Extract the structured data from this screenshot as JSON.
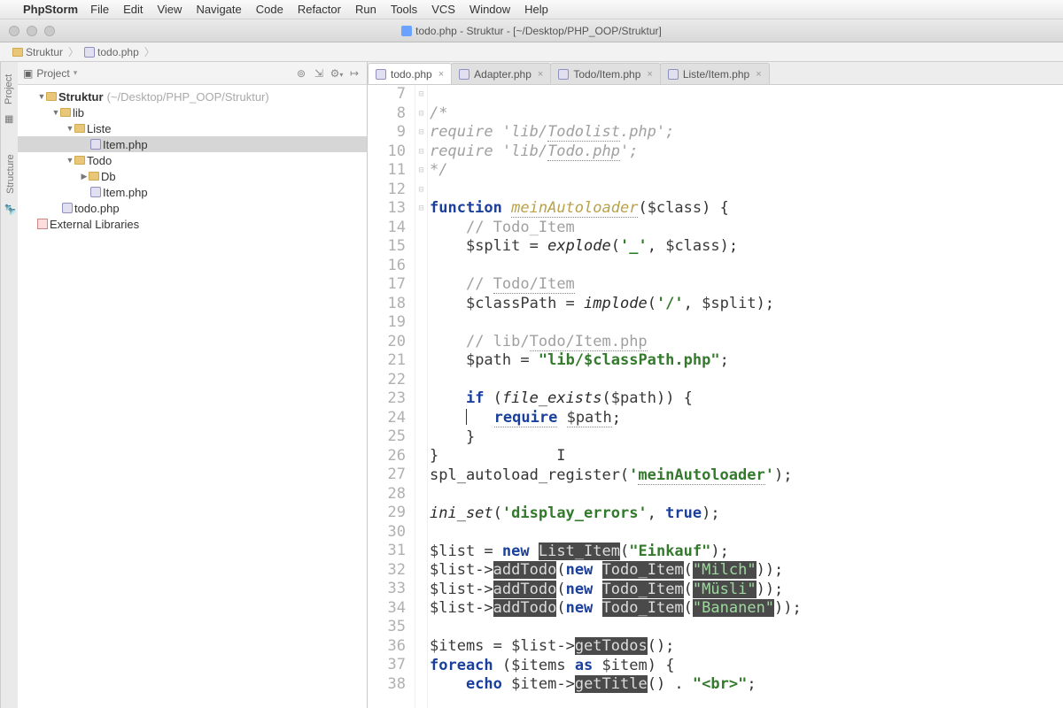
{
  "menubar": {
    "apple": "",
    "appname": "PhpStorm",
    "items": [
      "File",
      "Edit",
      "View",
      "Navigate",
      "Code",
      "Refactor",
      "Run",
      "Tools",
      "VCS",
      "Window",
      "Help"
    ]
  },
  "titlebar": {
    "title": "todo.php - Struktur - [~/Desktop/PHP_OOP/Struktur]"
  },
  "breadcrumb": {
    "items": [
      "Struktur",
      "todo.php"
    ]
  },
  "left_gutter": {
    "project": "Project",
    "structure": "Structure"
  },
  "sidebar": {
    "header": {
      "label": "Project"
    },
    "tree": {
      "root": {
        "label": "Struktur",
        "hint": "(~/Desktop/PHP_OOP/Struktur)"
      },
      "lib": "lib",
      "liste": "Liste",
      "liste_item": "Item.php",
      "todo": "Todo",
      "db": "Db",
      "todo_item": "Item.php",
      "todophp": "todo.php",
      "ext": "External Libraries"
    }
  },
  "tabs": [
    {
      "label": "todo.php",
      "active": true
    },
    {
      "label": "Adapter.php",
      "active": false
    },
    {
      "label": "Todo/Item.php",
      "active": false
    },
    {
      "label": "Liste/Item.php",
      "active": false
    }
  ],
  "code": {
    "first_line": 7,
    "lines": [
      {
        "n": 7,
        "html": ""
      },
      {
        "n": 8,
        "html": "<span class='c-cm'>/*</span>"
      },
      {
        "n": 9,
        "html": "<span class='c-cm'>require 'lib/</span><span class='c-cm c-ul'>Todolist</span><span class='c-cm'>.php';</span>"
      },
      {
        "n": 10,
        "html": "<span class='c-cm'>require 'lib/</span><span class='c-cm c-ul'>Todo.php</span><span class='c-cm'>';</span>"
      },
      {
        "n": 11,
        "html": "<span class='c-cm'>*/</span>"
      },
      {
        "n": 12,
        "html": ""
      },
      {
        "n": 13,
        "html": "<span class='c-kw'>function</span> <span class='c-def c-ul'>meinAutoloader</span>(<span class='c-var'>$class</span>) {"
      },
      {
        "n": 14,
        "html": "    <span class='c-cm2'>// Todo_Item</span>"
      },
      {
        "n": 15,
        "html": "    <span class='c-var'>$split</span> = <span class='c-fn'>explode</span>(<span class='c-str'>'_'</span>, <span class='c-var'>$class</span>);"
      },
      {
        "n": 16,
        "html": ""
      },
      {
        "n": 17,
        "html": "    <span class='c-cm2'>// </span><span class='c-cm2 c-ul'>Todo/Item</span>"
      },
      {
        "n": 18,
        "html": "    <span class='c-var'>$classPath</span> = <span class='c-fn'>implode</span>(<span class='c-str'>'/'</span>, <span class='c-var'>$split</span>);"
      },
      {
        "n": 19,
        "html": ""
      },
      {
        "n": 20,
        "html": "    <span class='c-cm2'>// lib/</span><span class='c-cm2 c-ul'>Todo/Item.php</span>"
      },
      {
        "n": 21,
        "html": "    <span class='c-var'>$path</span> = <span class='c-str'>\"lib/$classPath.php\"</span>;"
      },
      {
        "n": 22,
        "html": ""
      },
      {
        "n": 23,
        "html": "    <span class='c-kw'>if</span> (<span class='c-fn'>file_exists</span>(<span class='c-var'>$path</span>)) {"
      },
      {
        "n": 24,
        "html": "    <span class='caret'></span>   <span class='c-kw c-ul'>require</span> <span class='c-var c-ul'>$path</span>;"
      },
      {
        "n": 25,
        "html": "    }"
      },
      {
        "n": 26,
        "html": "}             I"
      },
      {
        "n": 27,
        "html": "spl_autoload_register(<span class='c-str'>'</span><span class='c-str c-ul'>meinAutoloader</span><span class='c-str'>'</span>);"
      },
      {
        "n": 28,
        "html": ""
      },
      {
        "n": 29,
        "html": "<span class='c-fn'>ini_set</span>(<span class='c-str'>'display_errors'</span>, <span class='c-kw'>true</span>);"
      },
      {
        "n": 30,
        "html": ""
      },
      {
        "n": 31,
        "html": "<span class='c-var'>$list</span> = <span class='c-kw'>new</span> <span class='c-hl'>List_Item</span>(<span class='c-str'>\"Einkauf\"</span>);"
      },
      {
        "n": 32,
        "html": "<span class='c-var'>$list</span>-><span class='c-hl'>addTodo</span>(<span class='c-kw'>new</span> <span class='c-hl'>Todo_Item</span>(<span class='c-hlstr'>\"Milch\"</span>));"
      },
      {
        "n": 33,
        "html": "<span class='c-var'>$list</span>-><span class='c-hl'>addTodo</span>(<span class='c-kw'>new</span> <span class='c-hl'>Todo_Item</span>(<span class='c-hlstr'>\"Müsli\"</span>));"
      },
      {
        "n": 34,
        "html": "<span class='c-var'>$list</span>-><span class='c-hl'>addTodo</span>(<span class='c-kw'>new</span> <span class='c-hl'>Todo_Item</span>(<span class='c-hlstr'>\"Bananen\"</span>));"
      },
      {
        "n": 35,
        "html": ""
      },
      {
        "n": 36,
        "html": "<span class='c-var'>$items</span> = <span class='c-var'>$list</span>-><span class='c-hl'>getTodos</span>();"
      },
      {
        "n": 37,
        "html": "<span class='c-kw'>foreach</span> (<span class='c-var'>$items</span> <span class='c-kw'>as</span> <span class='c-var'>$item</span>) {"
      },
      {
        "n": 38,
        "html": "    <span class='c-kw'>echo</span> <span class='c-var'>$item</span>-><span class='c-hl'>getTitle</span>() . <span class='c-str'>\"&lt;br&gt;\"</span>;"
      }
    ]
  }
}
